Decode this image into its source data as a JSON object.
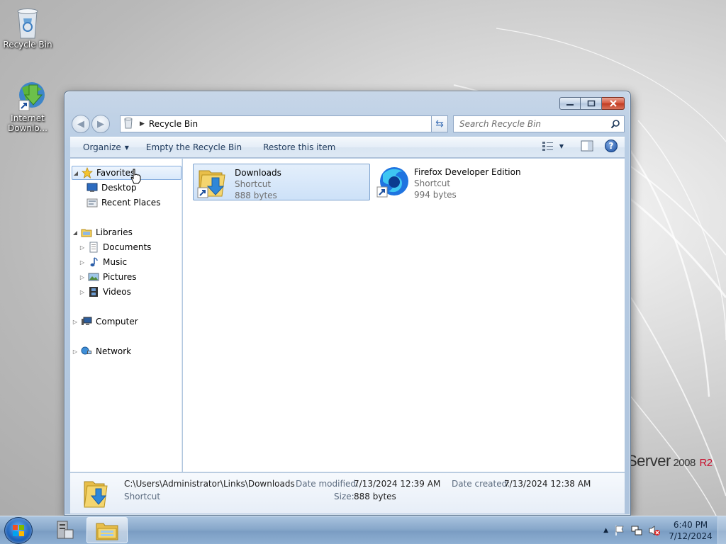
{
  "desktop": {
    "icons": [
      {
        "label": "Recycle Bin",
        "icon": "recycle-bin-icon"
      },
      {
        "label": "Internet Downlo...",
        "icon": "internet-download-manager-icon"
      }
    ],
    "branding": {
      "server": "Server",
      "version": "2008",
      "r2": "R2"
    }
  },
  "window": {
    "controls": {
      "minimize": "minimize",
      "maximize": "maximize",
      "close": "close"
    },
    "address": {
      "icon": "recycle-bin-icon",
      "location": "Recycle Bin"
    },
    "search": {
      "placeholder": "Search Recycle Bin"
    },
    "toolbar": {
      "organize": "Organize",
      "empty": "Empty the Recycle Bin",
      "restore": "Restore this item"
    },
    "navigation": {
      "favorites": "Favorites",
      "desktop": "Desktop",
      "recent": "Recent Places",
      "libraries": "Libraries",
      "documents": "Documents",
      "music": "Music",
      "pictures": "Pictures",
      "videos": "Videos",
      "computer": "Computer",
      "network": "Network"
    },
    "items": [
      {
        "name": "Downloads",
        "type": "Shortcut",
        "size": "888 bytes",
        "selected": true
      },
      {
        "name": "Firefox Developer Edition",
        "type": "Shortcut",
        "size": "994 bytes",
        "selected": false
      }
    ],
    "details": {
      "path": "C:\\Users\\Administrator\\Links\\Downloads",
      "type": "Shortcut",
      "modified_label": "Date modified:",
      "modified_value": "7/13/2024 12:39 AM",
      "created_label": "Date created:",
      "created_value": "7/13/2024 12:38 AM",
      "size_label": "Size:",
      "size_value": "888 bytes"
    }
  },
  "taskbar": {
    "clock": {
      "time": "6:40 PM",
      "date": "7/12/2024"
    },
    "tray_icons": [
      "show-hidden-icons-arrow",
      "action-center-flag-icon",
      "network-icon",
      "volume-muted-icon"
    ]
  },
  "colors": {
    "accent": "#3b6fb5",
    "selection": "#cde1f8",
    "close": "#c03b22"
  }
}
